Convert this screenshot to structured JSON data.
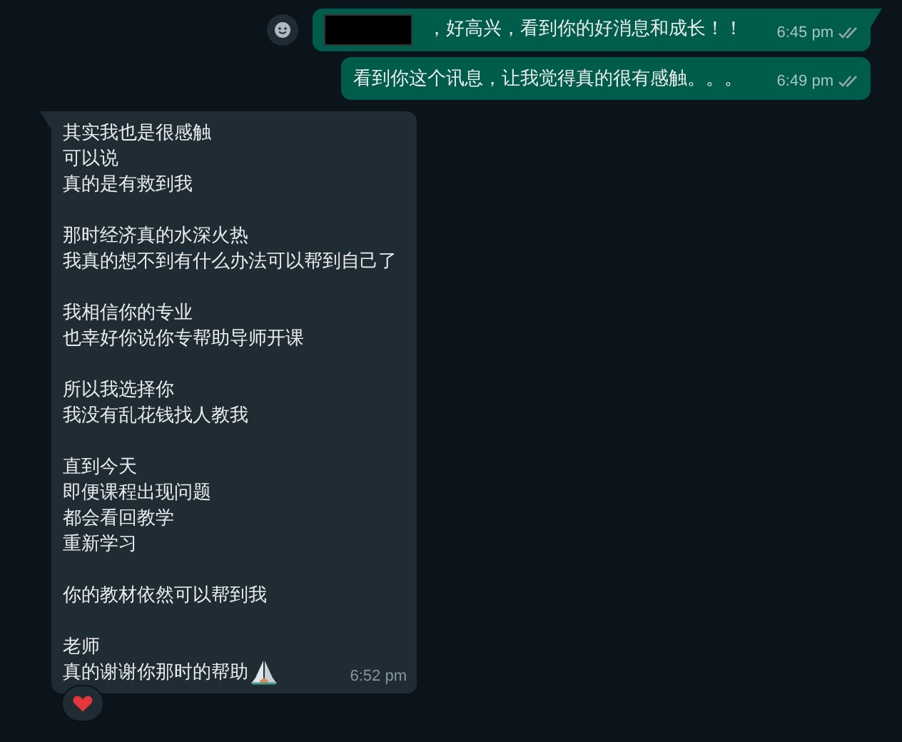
{
  "outgoing": [
    {
      "redacted_prefix": true,
      "text": "，好高兴，看到你的好消息和成长！！",
      "time": "6:45 pm",
      "read": false,
      "tail": true
    },
    {
      "redacted_prefix": false,
      "text": "看到你这个讯息，让我觉得真的很有感触。。。",
      "time": "6:49 pm",
      "read": false,
      "tail": false
    }
  ],
  "incoming": {
    "paragraphs": [
      [
        "其实我也是很感触",
        "可以说",
        "真的是有救到我"
      ],
      [
        "那时经济真的水深火热",
        "我真的想不到有什么办法可以帮到自己了"
      ],
      [
        "我相信你的专业",
        "也幸好你说你专帮助导师开课"
      ],
      [
        "所以我选择你",
        "我没有乱花钱找人教我"
      ],
      [
        "直到今天",
        "即便课程出现问题",
        "都会看回教学",
        "重新学习"
      ],
      [
        "你的教材依然可以帮到我"
      ],
      [
        "老师",
        "真的谢谢你那时的帮助"
      ]
    ],
    "time": "6:52 pm",
    "reaction": {
      "kind": "heart"
    }
  }
}
